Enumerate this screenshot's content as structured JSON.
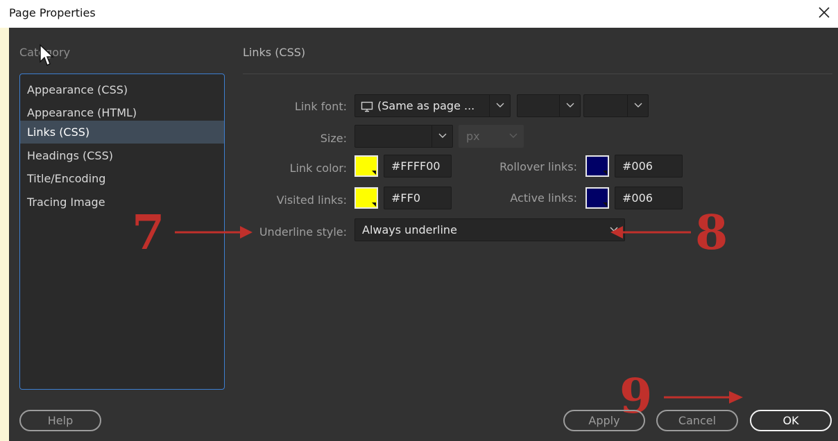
{
  "window": {
    "title": "Page Properties",
    "close_icon": "close-icon"
  },
  "sidebar": {
    "label": "Category",
    "items": [
      {
        "label": "Appearance (CSS)",
        "selected": false
      },
      {
        "label": "Appearance (HTML)",
        "selected": false
      },
      {
        "label": "Links (CSS)",
        "selected": true
      },
      {
        "label": "Headings (CSS)",
        "selected": false
      },
      {
        "label": "Title/Encoding",
        "selected": false
      },
      {
        "label": "Tracing Image",
        "selected": false
      }
    ]
  },
  "panel": {
    "title": "Links (CSS)",
    "link_font": {
      "label": "Link font:",
      "value": "(Same as page ...",
      "icon": "monitor-icon",
      "style_value": "",
      "weight_value": ""
    },
    "size": {
      "label": "Size:",
      "value": "",
      "unit": "px"
    },
    "link_color": {
      "label": "Link color:",
      "hex": "#FFFF00",
      "swatch": "#ffff00"
    },
    "rollover_links": {
      "label": "Rollover links:",
      "hex": "#006",
      "swatch": "#000066"
    },
    "visited_links": {
      "label": "Visited links:",
      "hex": "#FF0",
      "swatch": "#ffff00"
    },
    "active_links": {
      "label": "Active links:",
      "hex": "#006",
      "swatch": "#000066"
    },
    "underline_style": {
      "label": "Underline style:",
      "value": "Always underline"
    }
  },
  "annotations": {
    "step7": "7",
    "step8": "8",
    "step9": "9",
    "color": "#c0302b"
  },
  "buttons": {
    "help": "Help",
    "apply": "Apply",
    "cancel": "Cancel",
    "ok": "OK"
  }
}
